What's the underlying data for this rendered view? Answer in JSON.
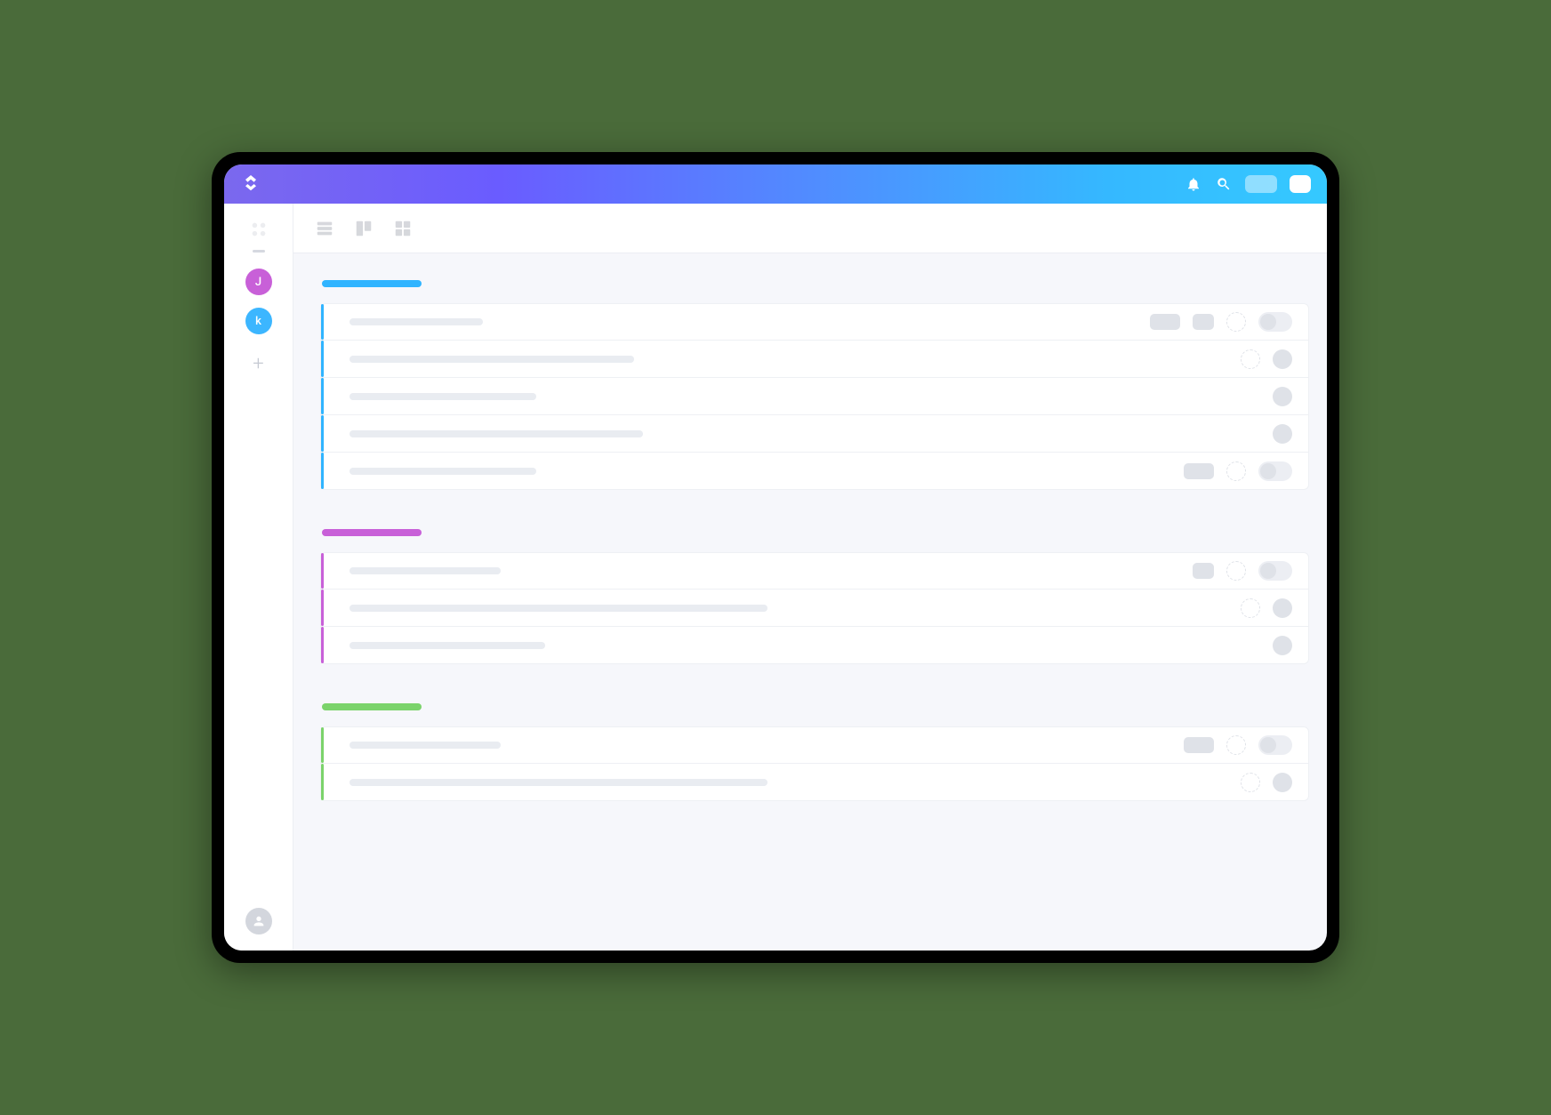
{
  "header": {
    "logo_name": "clickup-logo",
    "notification_icon": "bell-icon",
    "search_icon": "search-icon"
  },
  "sidebar": {
    "avatars": [
      {
        "letter": "J",
        "color": "pink"
      },
      {
        "letter": "k",
        "color": "blue"
      }
    ],
    "add_label": "+"
  },
  "viewbar": {
    "views": [
      {
        "name": "list-view-icon"
      },
      {
        "name": "board-view-icon"
      },
      {
        "name": "box-view-icon"
      }
    ]
  },
  "groups": [
    {
      "color": "#30b4ff",
      "tasks": [
        {
          "title_w": 150,
          "meta": [
            "pill-w1",
            "pill-w2",
            "dashed",
            "toggle"
          ]
        },
        {
          "title_w": 320,
          "meta": [
            "dashed",
            "solid"
          ]
        },
        {
          "title_w": 210,
          "meta": [
            "solid"
          ]
        },
        {
          "title_w": 330,
          "meta": [
            "solid"
          ]
        },
        {
          "title_w": 210,
          "meta": [
            "pill-w1",
            "dashed",
            "toggle"
          ]
        }
      ]
    },
    {
      "color": "#c860d8",
      "tasks": [
        {
          "title_w": 170,
          "meta": [
            "pill-w2",
            "dashed",
            "toggle"
          ]
        },
        {
          "title_w": 470,
          "meta": [
            "dashed",
            "solid"
          ]
        },
        {
          "title_w": 220,
          "meta": [
            "solid"
          ]
        }
      ]
    },
    {
      "color": "#7bd36b",
      "tasks": [
        {
          "title_w": 170,
          "meta": [
            "pill-w1",
            "dashed",
            "toggle"
          ]
        },
        {
          "title_w": 470,
          "meta": [
            "dashed",
            "solid"
          ]
        }
      ]
    }
  ]
}
